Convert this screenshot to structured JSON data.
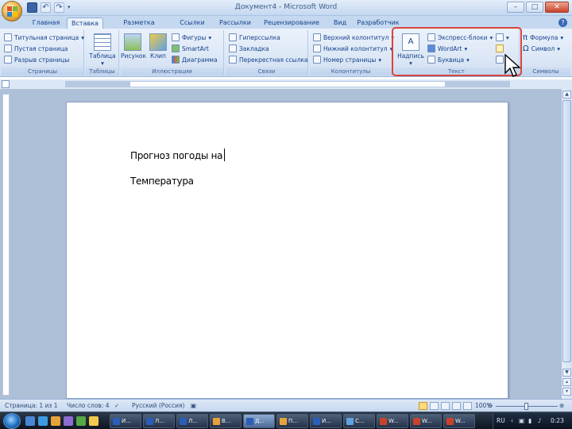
{
  "window": {
    "title": "Документ4 - Microsoft Word"
  },
  "tabs": [
    "Главная",
    "Вставка",
    "Разметка страницы",
    "Ссылки",
    "Рассылки",
    "Рецензирование",
    "Вид",
    "Разработчик"
  ],
  "active_tab": "Вставка",
  "ribbon": {
    "pages": {
      "label": "Страницы",
      "items": [
        "Титульная страница",
        "Пустая страница",
        "Разрыв страницы"
      ]
    },
    "tables": {
      "label": "Таблицы",
      "button": "Таблица"
    },
    "illustrations": {
      "label": "Иллюстрации",
      "items": [
        "Рисунок",
        "Клип",
        "Фигуры",
        "SmartArt",
        "Диаграмма"
      ]
    },
    "links": {
      "label": "Связи",
      "items": [
        "Гиперссылка",
        "Закладка",
        "Перекрестная ссылка"
      ]
    },
    "header_footer": {
      "label": "Колонтитулы",
      "items": [
        "Верхний колонтитул",
        "Нижний колонтитул",
        "Номер страницы"
      ]
    },
    "text": {
      "label": "Текст",
      "textbox": "Надпись",
      "items": [
        "Экспресс-блоки",
        "WordArt",
        "Буквица"
      ]
    },
    "symbols": {
      "label": "Символы",
      "items": [
        "Формула",
        "Символ"
      ]
    }
  },
  "document": {
    "line1": "Прогноз погоды на",
    "line2": "Температура"
  },
  "statusbar": {
    "page": "Страница: 1 из 1",
    "words": "Число слов: 4",
    "language": "Русский (Россия)",
    "zoom": "100%"
  },
  "taskbar": {
    "buttons": [
      "И...",
      "Л...",
      "Л...",
      "В...",
      "Д...",
      "П...",
      "И...",
      "С...",
      "W...",
      "W...",
      "W..."
    ],
    "lang": "RU",
    "time": "0:23"
  },
  "colors": {
    "highlight": "#d9453c",
    "ribbon_text": "#15428b",
    "accent": "#c4d8f0"
  },
  "icons": [
    "office-button-icon",
    "save-icon",
    "undo-icon",
    "redo-icon",
    "help-icon",
    "mouse-cursor-icon",
    "start-icon"
  ]
}
